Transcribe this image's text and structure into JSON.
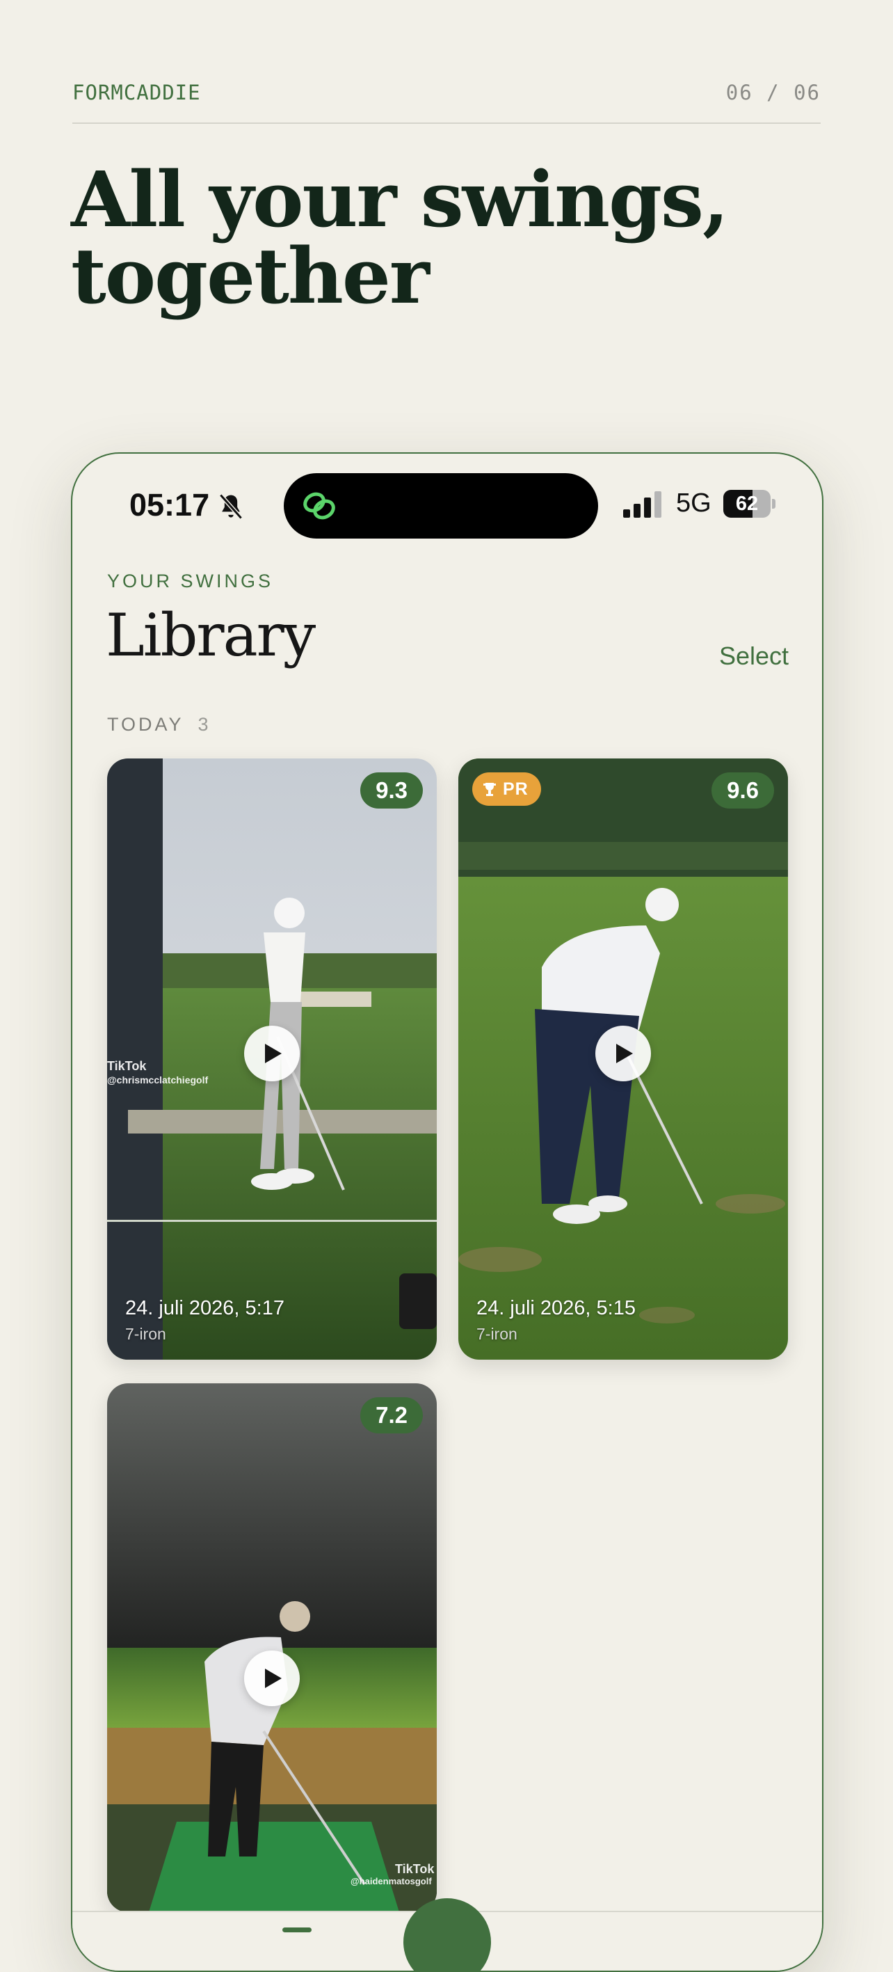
{
  "header": {
    "brand": "FORMCADDIE",
    "pager": "06 / 06",
    "headline": "All your swings, together"
  },
  "status_bar": {
    "time": "05:17",
    "network": "5G",
    "battery_level": "62",
    "battery_fraction": 0.62,
    "icons": [
      "bell-slash-icon",
      "app-logo-icon",
      "signal-icon",
      "battery-icon"
    ]
  },
  "library": {
    "eyebrow": "YOUR SWINGS",
    "title": "Library",
    "select_label": "Select",
    "section": {
      "label": "TODAY",
      "count": "3"
    },
    "cards": [
      {
        "score": "9.3",
        "date": "24. juli 2026, 5:17",
        "club": "7-iron",
        "watermark": "TikTok",
        "handle": "@chrismcclatchiegolf"
      },
      {
        "badge": "PR",
        "score": "9.6",
        "date": "24. juli 2026, 5:15",
        "club": "7-iron"
      },
      {
        "score": "7.2",
        "watermark": "TikTok",
        "handle": "@haidenmatosgolf"
      }
    ]
  },
  "colors": {
    "background": "#f2f0e8",
    "accent_green": "#41703f",
    "badge_orange": "#e8a23a",
    "ink": "#13261a"
  }
}
